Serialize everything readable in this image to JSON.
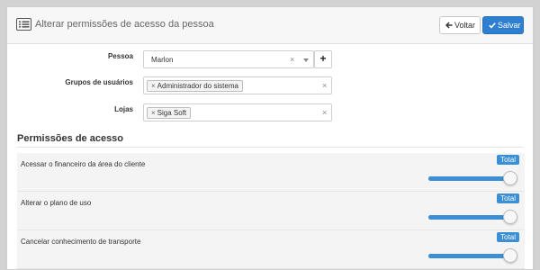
{
  "header": {
    "title": "Alterar permissões de acesso da pessoa",
    "icon": "list-icon",
    "back_label": "Voltar",
    "save_label": "Salvar"
  },
  "form": {
    "pessoa": {
      "label": "Pessoa",
      "value": "Marlon",
      "clear": "×",
      "add": "+"
    },
    "grupos": {
      "label": "Grupos de usuários",
      "tags": [
        "Administrador do sistema"
      ],
      "clear": "×"
    },
    "lojas": {
      "label": "Lojas",
      "tags": [
        "Siga Soft"
      ],
      "clear": "×"
    }
  },
  "permissions": {
    "title": "Permissões de acesso",
    "items": [
      {
        "label": "Acessar o financeiro da área do cliente",
        "badge": "Total",
        "level": 1.0
      },
      {
        "label": "Alterar o plano de uso",
        "badge": "Total",
        "level": 1.0
      },
      {
        "label": "Cancelar conhecimento de transporte",
        "badge": "Total",
        "level": 1.0
      }
    ]
  },
  "colors": {
    "accent": "#2f7fd0",
    "badge": "#3a8fd5",
    "background": "#d2d2d2"
  }
}
